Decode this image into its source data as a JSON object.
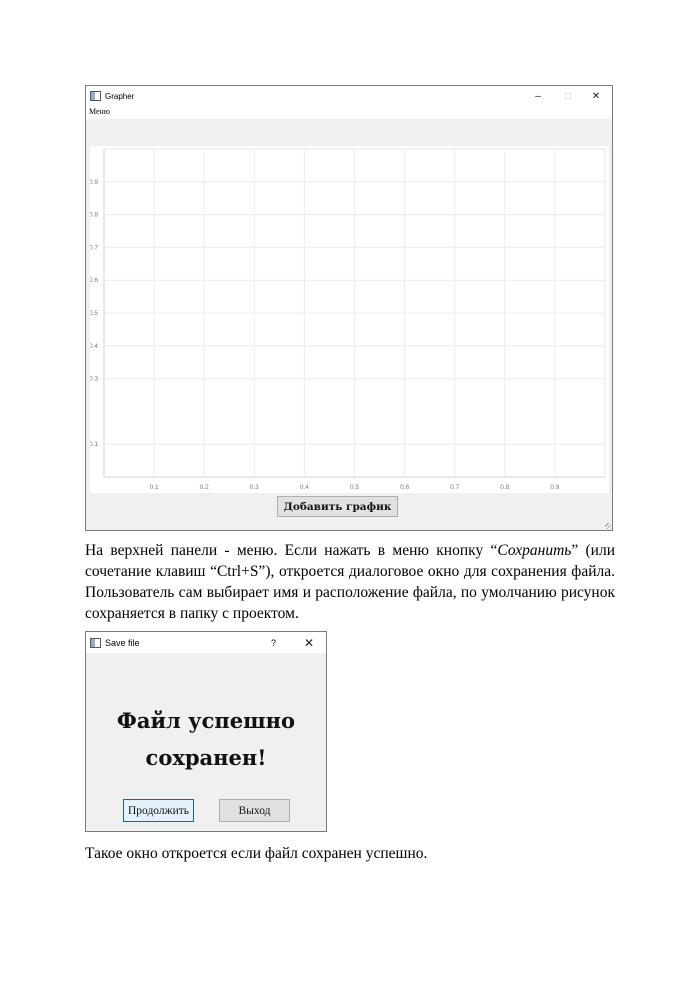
{
  "grapher_window": {
    "title": "Grapher",
    "controls": {
      "minimize": "–",
      "maximize": "□",
      "close": "✕"
    },
    "menu": {
      "label": "Меню"
    },
    "add_button": "Добавить график"
  },
  "chart_data": {
    "type": "line",
    "title": "",
    "xlabel": "",
    "ylabel": "",
    "xlim": [
      0,
      1
    ],
    "ylim": [
      0,
      1
    ],
    "x_ticks": [
      "0.1",
      "0.2",
      "0.3",
      "0.4",
      "0.5",
      "0.6",
      "0.7",
      "0.8",
      "0.9"
    ],
    "y_ticks": [
      "0.1",
      "0.3",
      "0.4",
      "0.5",
      "0.6",
      "0.7",
      "0.8",
      "0.9"
    ],
    "grid": true,
    "series": []
  },
  "paragraph1": {
    "before": "На верхней панели - меню. Если нажать в меню кнопку “",
    "italic": "Сохранить",
    "after": "” (или сочетание клавиш “Ctrl+S”), откроется диалоговое окно для сохранения файла. Пользователь сам выбирает имя и расположение файла, по умолчанию рисунок сохраняется в папку с проектом."
  },
  "save_dialog": {
    "title": "Save file",
    "help": "?",
    "close": "✕",
    "message_line1": "Файл успешно",
    "message_line2": "сохранен!",
    "continue_button": "Продолжить",
    "exit_button": "Выход"
  },
  "paragraph2": "Такое окно откроется если файл сохранен успешно."
}
